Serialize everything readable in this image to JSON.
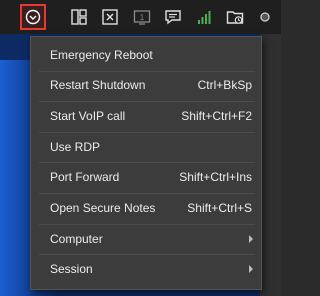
{
  "toolbar": {
    "icons": [
      "chevron-down-circle-icon",
      "layout-split-icon",
      "fullscreen-x-icon",
      "screen-number-icon",
      "chat-icon",
      "signal-bars-icon",
      "folder-sync-icon",
      "status-dot-icon"
    ],
    "screen_number": "1",
    "accent_color": "#e53935",
    "signal_color": "#4caf50"
  },
  "menu": {
    "items": [
      {
        "label": "Emergency Reboot",
        "shortcut": ""
      },
      {
        "label": "Restart  Shutdown",
        "shortcut": "Ctrl+BkSp"
      },
      {
        "label": "Start VoIP call",
        "shortcut": "Shift+Ctrl+F2"
      },
      {
        "label": "Use RDP",
        "shortcut": ""
      },
      {
        "label": "Port Forward",
        "shortcut": "Shift+Ctrl+Ins"
      },
      {
        "label": "Open Secure Notes",
        "shortcut": "Shift+Ctrl+S"
      },
      {
        "label": "Computer",
        "shortcut": ""
      },
      {
        "label": "Session",
        "shortcut": ""
      }
    ]
  }
}
